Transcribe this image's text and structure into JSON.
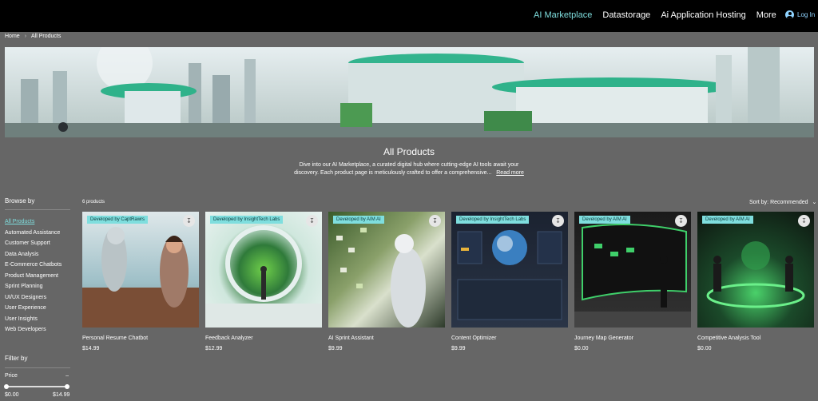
{
  "header": {
    "nav": [
      {
        "label": "AI Marketplace",
        "active": true
      },
      {
        "label": "Datastorage",
        "active": false
      },
      {
        "label": "Ai Application Hosting",
        "active": false
      },
      {
        "label": "More",
        "active": false
      }
    ],
    "login_label": "Log In",
    "accent_color": "#7fdede"
  },
  "breadcrumb": {
    "home": "Home",
    "current": "All Products"
  },
  "intro": {
    "title": "All Products",
    "line1": "Dive into our AI Marketplace, a curated digital hub where cutting-edge AI tools await your",
    "line2": "discovery. Each product page is meticulously crafted to offer a comprehensive...",
    "read_more": "Read more"
  },
  "sidebar": {
    "browse_title": "Browse by",
    "categories": [
      "All Products",
      "Automated Assistance",
      "Customer Support",
      "Data Analysis",
      "E-Commerce Chatbots",
      "Product Management",
      "Sprint Planning",
      "UI/UX Designers",
      "User Experience",
      "User Insights",
      "Web Developers"
    ],
    "active_category": "All Products",
    "filter_title": "Filter by",
    "price_label": "Price",
    "price_min": "$0.00",
    "price_max": "$14.99"
  },
  "products": {
    "count_label": "6 products",
    "sort_label": "Sort by: Recommended",
    "items": [
      {
        "badge": "Developed by CaptRawrs",
        "name": "Personal Resume Chatbot",
        "price": "$14.99"
      },
      {
        "badge": "Developed by InsightTech Labs",
        "name": "Feedback Analyzer",
        "price": "$12.99"
      },
      {
        "badge": "Developed by AIM AI",
        "name": "AI Sprint Assistant",
        "price": "$9.99"
      },
      {
        "badge": "Developed by InsightTech Labs",
        "name": "Content Optimizer",
        "price": "$9.99"
      },
      {
        "badge": "Developed by AIM AI",
        "name": "Journey Map Generator",
        "price": "$0.00"
      },
      {
        "badge": "Developed by AIM AI",
        "name": "Competitive Analysis Tool",
        "price": "$0.00"
      }
    ]
  }
}
